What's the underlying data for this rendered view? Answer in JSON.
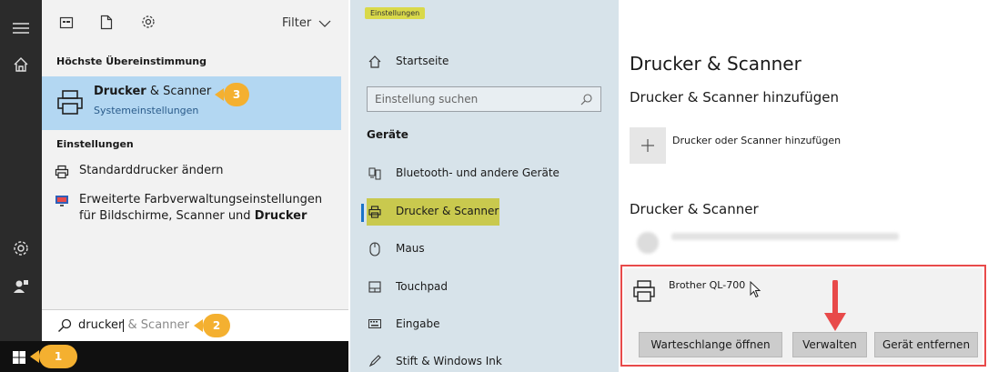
{
  "start_menu": {
    "filter_label": "Filter",
    "best_match_header": "Höchste Übereinstimmung",
    "best_match": {
      "title_bold": "Drucker",
      "title_rest": " & Scanner",
      "subtitle": "Systemeinstellungen",
      "badge": "3"
    },
    "settings_header": "Einstellungen",
    "items": [
      {
        "label": "Standarddrucker ändern"
      },
      {
        "line1": "Erweiterte Farbverwaltungseinstellungen",
        "line2_pre": "für Bildschirme, Scanner und ",
        "line2_bold": "Drucker"
      }
    ],
    "search": {
      "typed": "drucker",
      "suggestion": " & Scanner",
      "badge": "2"
    },
    "taskbar_badge": "1"
  },
  "settings_nav": {
    "window_title": "Einstellungen",
    "home_label": "Startseite",
    "search_placeholder": "Einstellung suchen",
    "section_header": "Geräte",
    "items": [
      {
        "label": "Bluetooth- und andere Geräte",
        "icon": "bluetooth-devices-icon"
      },
      {
        "label": "Drucker & Scanner",
        "icon": "printer-icon",
        "active": true
      },
      {
        "label": "Maus",
        "icon": "mouse-icon"
      },
      {
        "label": "Touchpad",
        "icon": "touchpad-icon"
      },
      {
        "label": "Eingabe",
        "icon": "keyboard-icon"
      },
      {
        "label": "Stift & Windows Ink",
        "icon": "pen-icon"
      }
    ]
  },
  "printers_page": {
    "title": "Drucker & Scanner",
    "add_header": "Drucker & Scanner hinzufügen",
    "add_label": "Drucker oder Scanner hinzufügen",
    "list_header": "Drucker & Scanner",
    "selected_printer": "Brother QL-700",
    "buttons": {
      "queue": "Warteschlange öffnen",
      "manage": "Verwalten",
      "remove": "Gerät entfernen"
    },
    "colors": {
      "highlight_red": "#e84a4a",
      "accent": "#1a73c8",
      "badge_orange": "#f4b030"
    }
  }
}
